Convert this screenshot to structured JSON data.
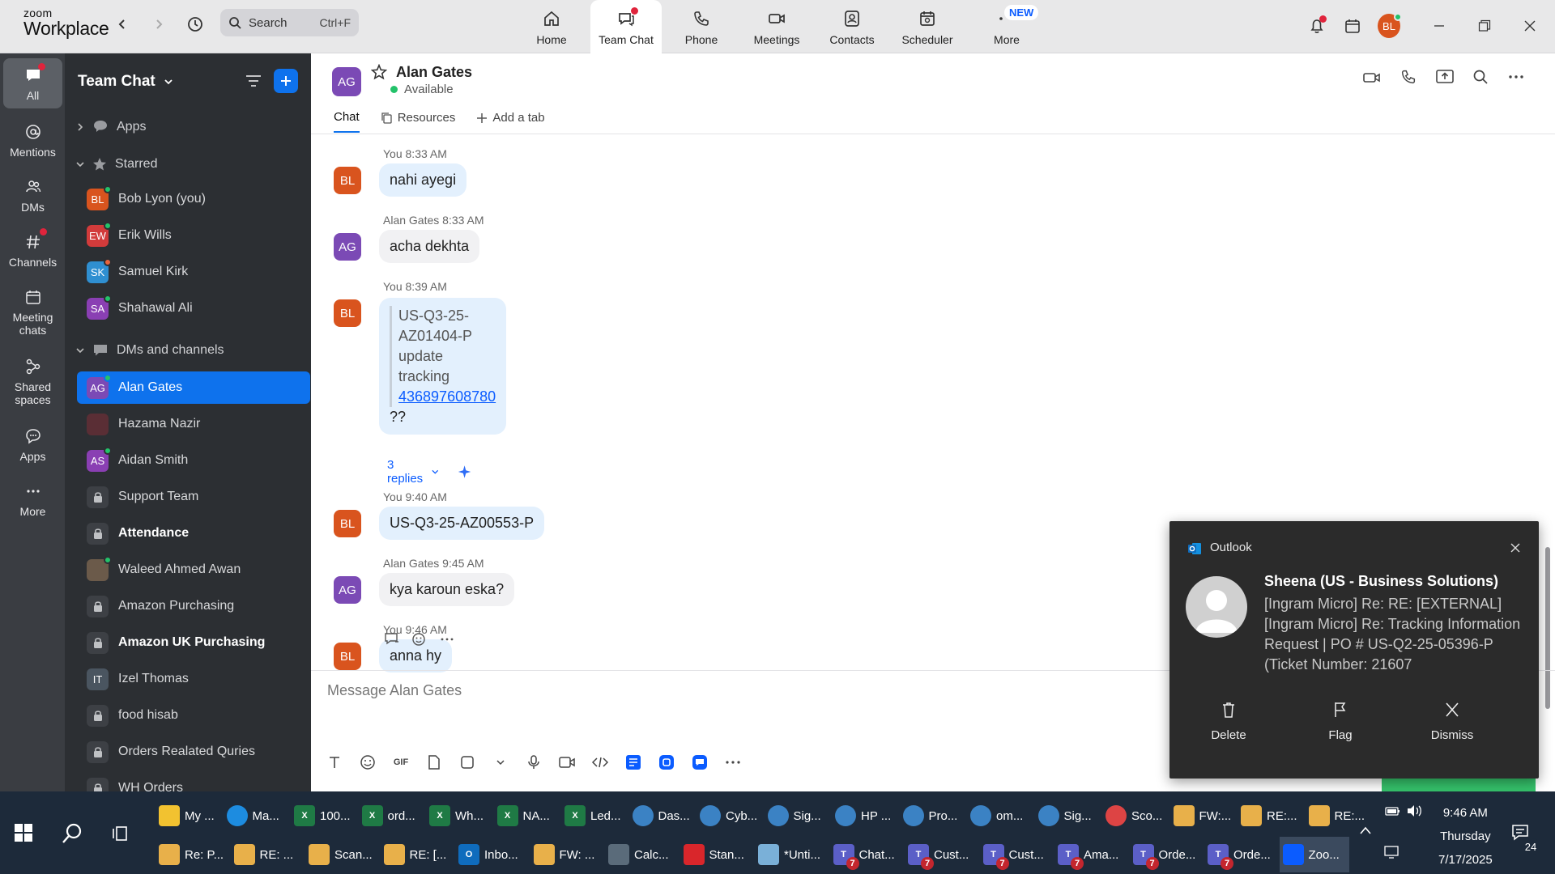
{
  "app": {
    "logo_line1": "zoom",
    "logo_line2": "Workplace"
  },
  "search": {
    "placeholder": "Search",
    "shortcut": "Ctrl+F"
  },
  "nav": [
    {
      "label": "Home",
      "icon": "home-icon"
    },
    {
      "label": "Team Chat",
      "icon": "chat-icon"
    },
    {
      "label": "Phone",
      "icon": "phone-icon"
    },
    {
      "label": "Meetings",
      "icon": "video-icon"
    },
    {
      "label": "Contacts",
      "icon": "contacts-icon"
    },
    {
      "label": "Scheduler",
      "icon": "calendar-icon"
    },
    {
      "label": "More",
      "icon": "more-icon"
    }
  ],
  "new_badge": "NEW",
  "user_initials": "BL",
  "rail": [
    {
      "label": "All"
    },
    {
      "label": "Mentions"
    },
    {
      "label": "DMs"
    },
    {
      "label": "Channels"
    },
    {
      "label": "Meeting chats"
    },
    {
      "label": "Shared spaces"
    },
    {
      "label": "Apps"
    },
    {
      "label": "More"
    }
  ],
  "panel": {
    "title": "Team Chat",
    "apps_label": "Apps",
    "starred_label": "Starred",
    "starred": [
      {
        "initials": "BL",
        "name": "Bob Lyon (you)",
        "color": "#d9541e"
      },
      {
        "initials": "EW",
        "name": "Erik Wills",
        "color": "#d23b3b"
      },
      {
        "initials": "SK",
        "name": "Samuel Kirk",
        "color": "#2f8fd1"
      },
      {
        "initials": "SA",
        "name": "Shahawal Ali",
        "color": "#8a3fb3"
      }
    ],
    "dms_label": "DMs and channels",
    "dms": [
      {
        "initials": "AG",
        "name": "Alan Gates",
        "color": "#7b4ab5"
      },
      {
        "initials": "",
        "name": "Hazama Nazir",
        "color": "#5a2e35"
      },
      {
        "initials": "AS",
        "name": "Aidan Smith",
        "color": "#8a3fb3"
      },
      {
        "initials": "",
        "name": "Support Team",
        "color": ""
      },
      {
        "initials": "",
        "name": "Attendance",
        "color": ""
      },
      {
        "initials": "",
        "name": "Waleed Ahmed Awan",
        "color": "#6b5a4a"
      },
      {
        "initials": "",
        "name": "Amazon Purchasing",
        "color": ""
      },
      {
        "initials": "",
        "name": "Amazon UK Purchasing",
        "color": ""
      },
      {
        "initials": "IT",
        "name": "Izel Thomas",
        "color": "#4a5560"
      },
      {
        "initials": "",
        "name": "food hisab",
        "color": ""
      },
      {
        "initials": "",
        "name": "Orders Realated Quries",
        "color": ""
      },
      {
        "initials": "",
        "name": "WH Orders",
        "color": ""
      }
    ]
  },
  "chat": {
    "contact_initials": "AG",
    "contact_name": "Alan Gates",
    "status": "Available",
    "tabs": [
      "Chat",
      "Resources",
      "Add a tab"
    ],
    "messages": [
      {
        "initials": "BL",
        "sender": "You",
        "time": "8:33 AM",
        "text": "nahi ayegi"
      },
      {
        "initials": "AG",
        "sender": "Alan Gates",
        "time": "8:33 AM",
        "text": "acha dekhta"
      },
      {
        "initials": "BL",
        "sender": "You",
        "time": "8:39 AM",
        "quote_line1": "US-Q3-25-AZ01404-P",
        "quote_line2": "update tracking",
        "quote_link": "436897608780",
        "text": "??",
        "replies": "3 replies"
      },
      {
        "initials": "BL",
        "sender": "You",
        "time": "9:40 AM",
        "text": "US-Q3-25-AZ00553-P"
      },
      {
        "initials": "AG",
        "sender": "Alan Gates",
        "time": "9:45 AM",
        "text": "kya karoun eska?"
      },
      {
        "initials": "BL",
        "sender": "You",
        "time": "9:46 AM",
        "text": "anna hy"
      }
    ],
    "composer_placeholder": "Message Alan Gates"
  },
  "toast": {
    "app": "Outlook",
    "sender": "Sheena (US - Business Solutions)",
    "body": "[Ingram Micro] Re: RE: [EXTERNAL] [Ingram Micro] Re: Tracking Information Request | PO # US-Q2-25-05396-P (Ticket Number: 21607",
    "actions": [
      "Delete",
      "Flag",
      "Dismiss"
    ]
  },
  "taskbar": {
    "row1": [
      {
        "label": "My ...",
        "icon": "folder-icon",
        "color": "#f2c230"
      },
      {
        "label": "Ma...",
        "icon": "edge-icon",
        "color": "#1d8ce0"
      },
      {
        "label": "100...",
        "icon": "excel-icon",
        "color": "#1f7a45"
      },
      {
        "label": "ord...",
        "icon": "excel-icon",
        "color": "#1f7a45"
      },
      {
        "label": "Wh...",
        "icon": "excel-icon",
        "color": "#1f7a45"
      },
      {
        "label": "NA...",
        "icon": "excel-icon",
        "color": "#1f7a45"
      },
      {
        "label": "Led...",
        "icon": "excel-icon",
        "color": "#1f7a45"
      },
      {
        "label": "Das...",
        "icon": "chrome-icon",
        "color": "#3b82c4"
      },
      {
        "label": "Cyb...",
        "icon": "chrome-icon",
        "color": "#3b82c4"
      },
      {
        "label": "Sig...",
        "icon": "chrome-icon",
        "color": "#3b82c4"
      },
      {
        "label": "HP ...",
        "icon": "chrome-icon",
        "color": "#3b82c4"
      },
      {
        "label": "Pro...",
        "icon": "chrome-icon",
        "color": "#3b82c4"
      },
      {
        "label": "om...",
        "icon": "chrome-icon",
        "color": "#3b82c4"
      },
      {
        "label": "Sig...",
        "icon": "chrome-icon",
        "color": "#3b82c4"
      },
      {
        "label": "Sco...",
        "icon": "chrome-icon",
        "color": "#d44"
      },
      {
        "label": "FW:...",
        "icon": "mail-icon",
        "color": "#e8b04a"
      },
      {
        "label": "RE:...",
        "icon": "mail-icon",
        "color": "#e8b04a"
      },
      {
        "label": "RE:...",
        "icon": "mail-icon",
        "color": "#e8b04a"
      }
    ],
    "row2": [
      {
        "label": "Re: P...",
        "icon": "mail-icon",
        "color": "#e8b04a"
      },
      {
        "label": "RE: ...",
        "icon": "mail-icon",
        "color": "#e8b04a"
      },
      {
        "label": "Scan...",
        "icon": "mail-icon",
        "color": "#e8b04a"
      },
      {
        "label": "RE: [...",
        "icon": "mail-icon",
        "color": "#e8b04a"
      },
      {
        "label": "Inbo...",
        "icon": "outlook-icon",
        "color": "#0f6cbd"
      },
      {
        "label": "FW: ...",
        "icon": "mail-icon",
        "color": "#e8b04a"
      },
      {
        "label": "Calc...",
        "icon": "calculator-icon",
        "color": "#5a6b7a"
      },
      {
        "label": "Stan...",
        "icon": "pdf-icon",
        "color": "#d9262b"
      },
      {
        "label": "*Unti...",
        "icon": "notepad-icon",
        "color": "#7ab0d8"
      },
      {
        "label": "Chat...",
        "icon": "teams-icon",
        "color": "#5b5fc7"
      },
      {
        "label": "Cust...",
        "icon": "teams-icon",
        "color": "#5b5fc7"
      },
      {
        "label": "Cust...",
        "icon": "teams-icon",
        "color": "#5b5fc7"
      },
      {
        "label": "Ama...",
        "icon": "teams-icon",
        "color": "#5b5fc7"
      },
      {
        "label": "Orde...",
        "icon": "teams-icon",
        "color": "#5b5fc7"
      },
      {
        "label": "Orde...",
        "icon": "teams-icon",
        "color": "#5b5fc7"
      },
      {
        "label": "Zoo...",
        "icon": "zoom-icon",
        "color": "#0b5cff"
      }
    ],
    "teams_badge": "7",
    "time": "9:46 AM",
    "day": "Thursday",
    "date": "7/17/2025",
    "notif_count": "24"
  }
}
